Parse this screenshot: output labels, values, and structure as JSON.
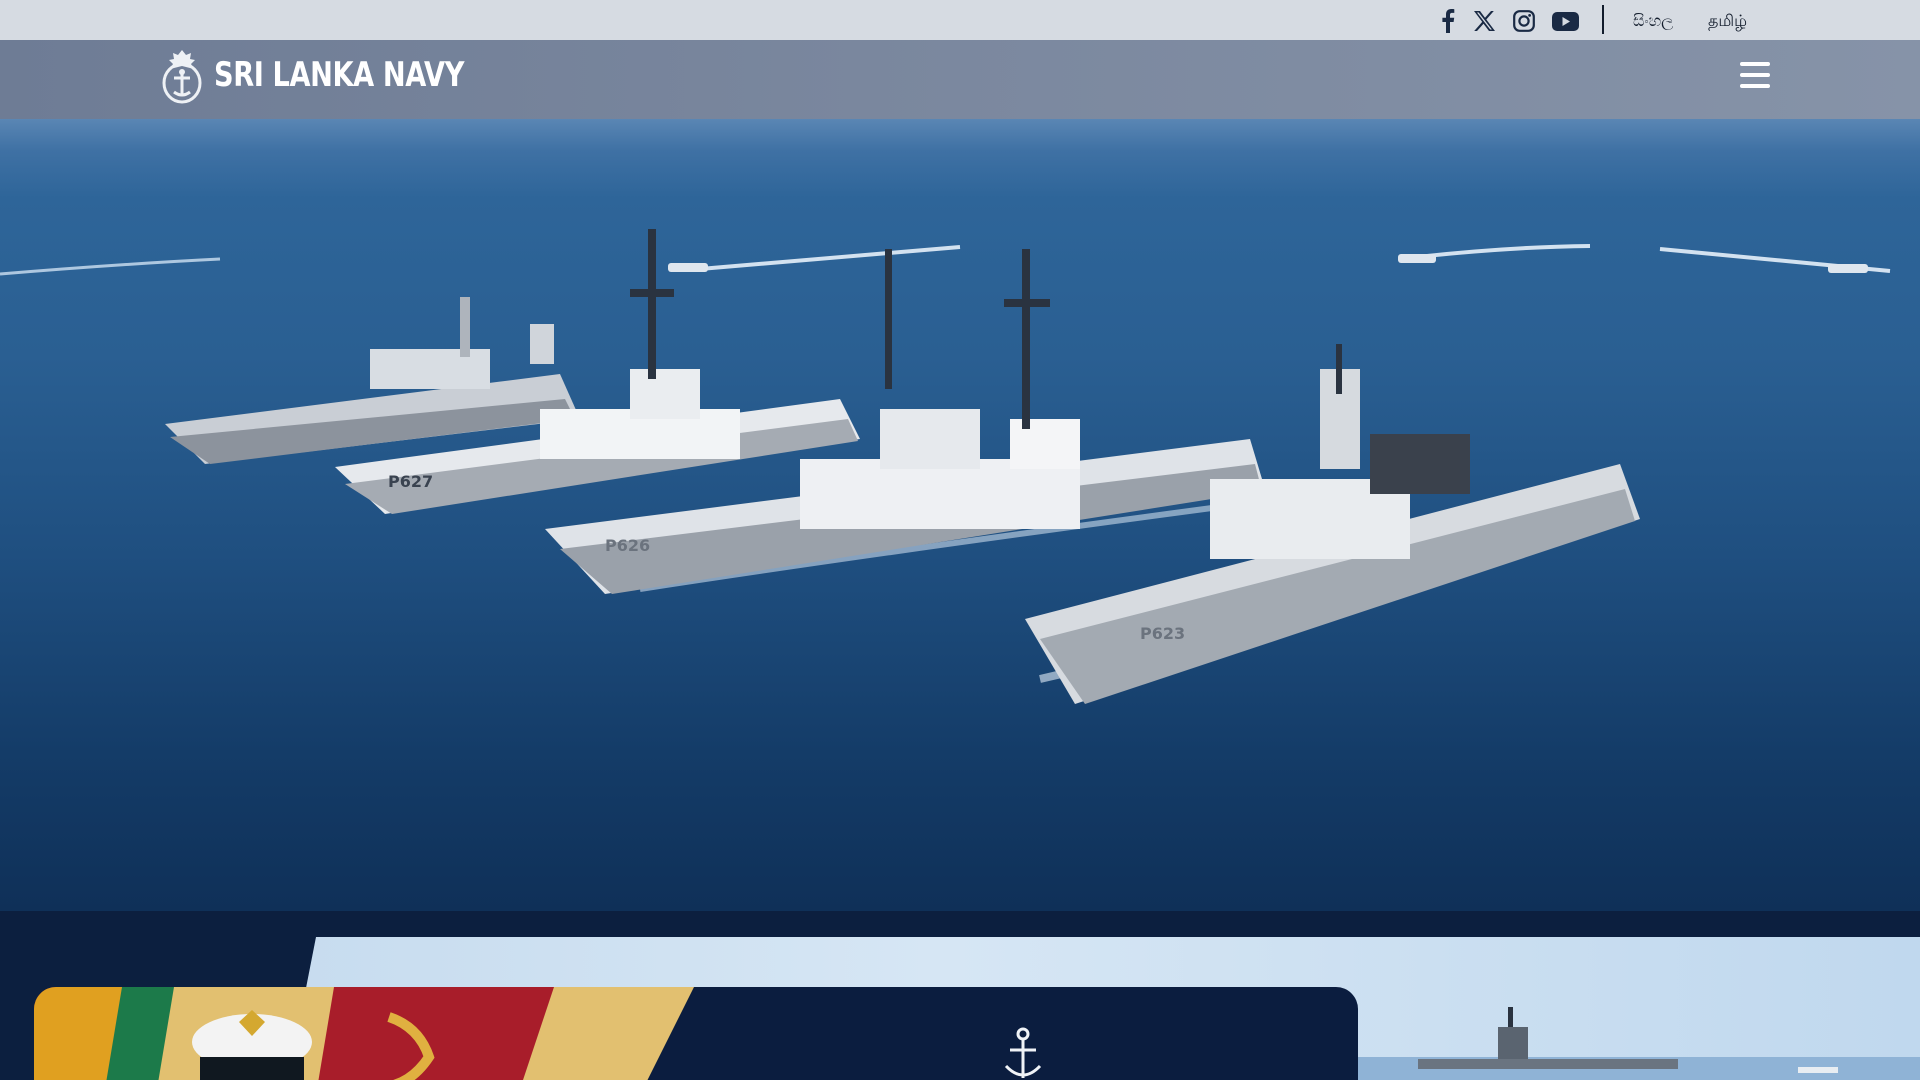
{
  "topbar": {
    "social": [
      {
        "name": "facebook-icon"
      },
      {
        "name": "x-twitter-icon"
      },
      {
        "name": "instagram-icon"
      },
      {
        "name": "youtube-icon"
      }
    ],
    "languages": [
      {
        "label": "සිංහල"
      },
      {
        "label": "தமிழ்"
      }
    ]
  },
  "header": {
    "logo_text": "SRI LANKA NAVY",
    "menu_icon": "hamburger-menu-icon"
  },
  "hero": {
    "hull_numbers": [
      "P627",
      "P626",
      "P623"
    ]
  },
  "colors": {
    "topbar_bg": "#d6dbe2",
    "header_bg": "#7a879e",
    "navy_dark": "#0b1d3d",
    "sea": "#1f4f80"
  }
}
